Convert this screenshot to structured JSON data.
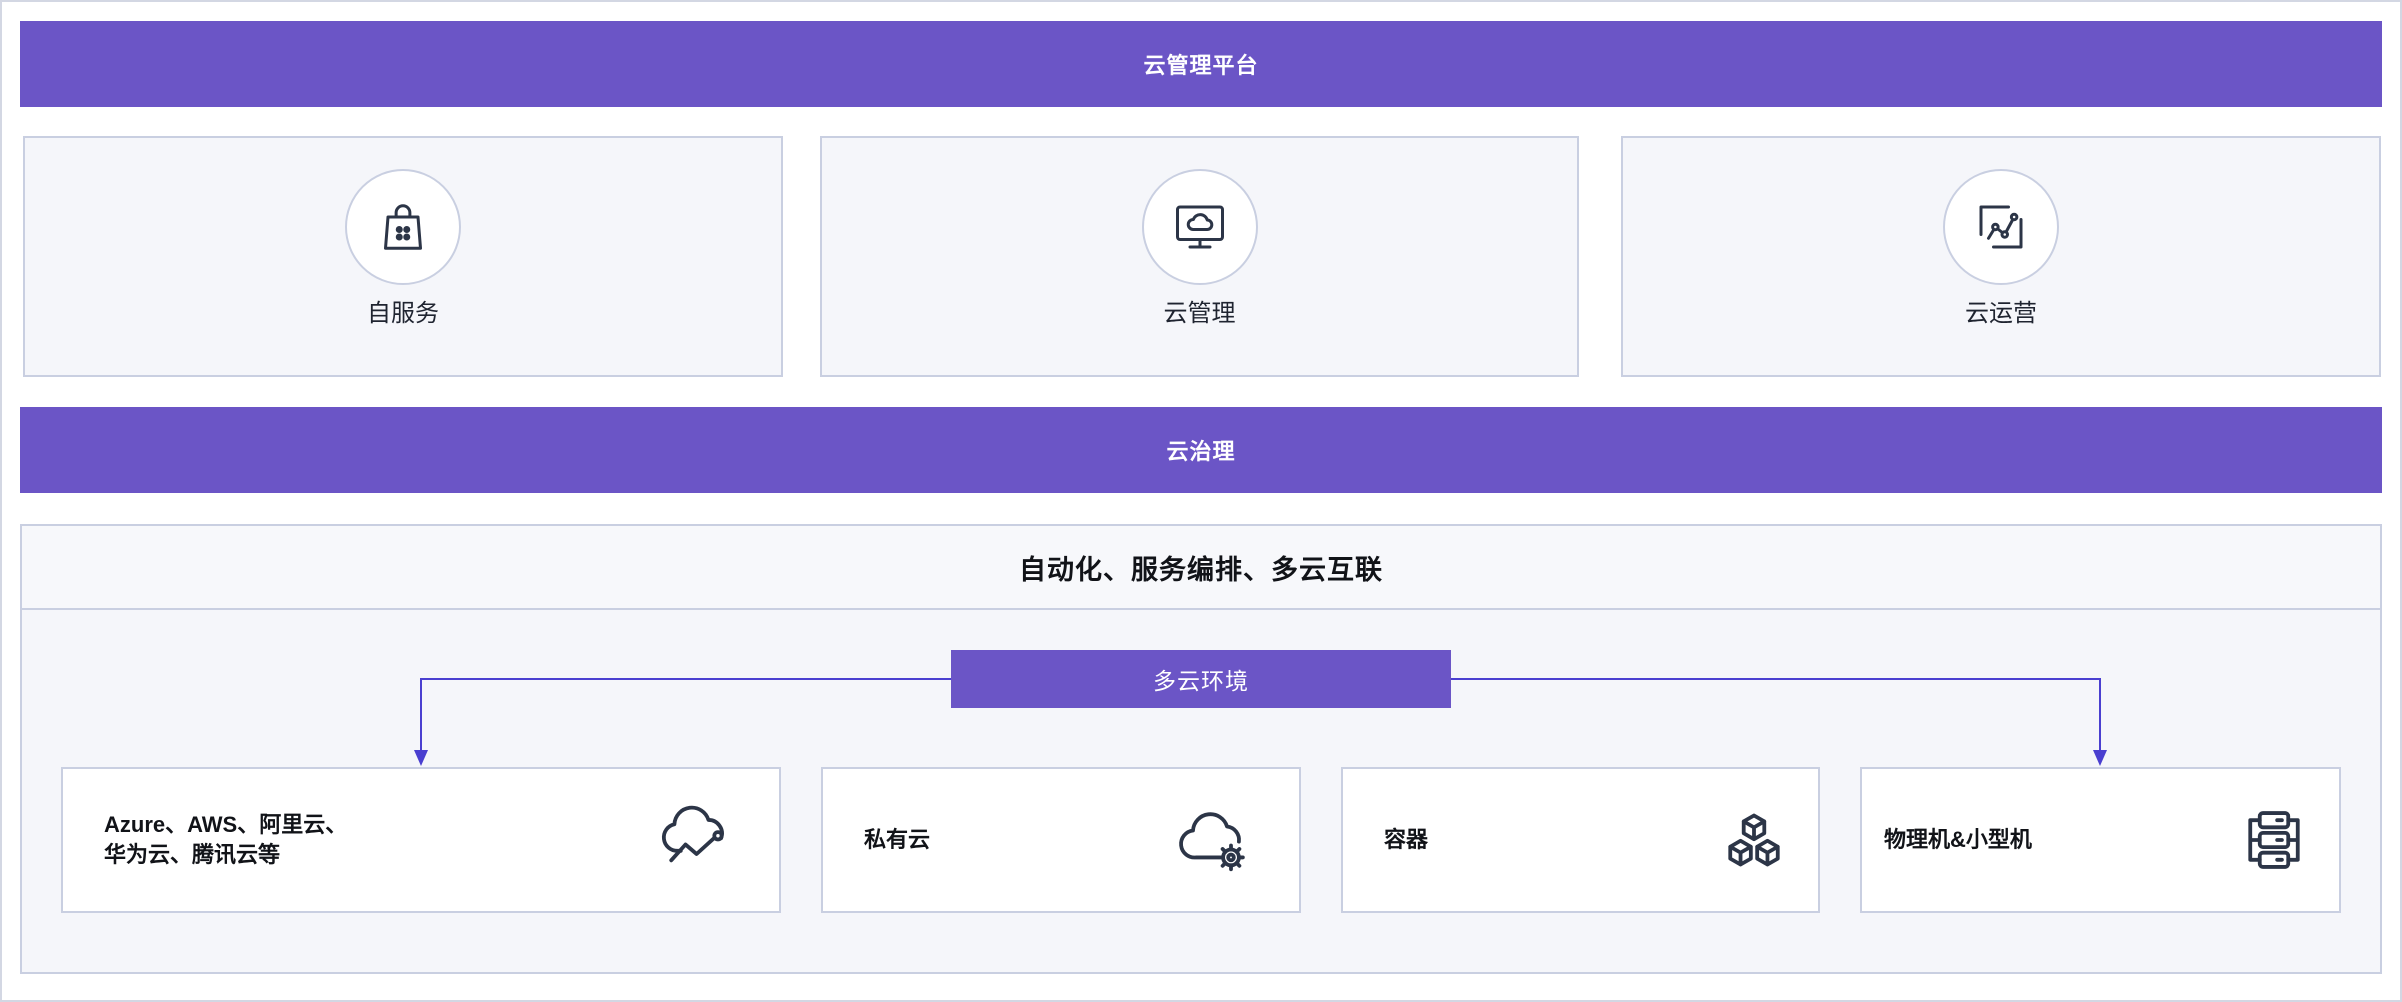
{
  "platform": {
    "title": "云管理平台"
  },
  "modules": [
    {
      "label": "自服务",
      "icon": "shopping-bag-icon"
    },
    {
      "label": "云管理",
      "icon": "monitor-cloud-icon"
    },
    {
      "label": "云运营",
      "icon": "line-chart-icon"
    }
  ],
  "governance": {
    "title": "云治理"
  },
  "environment": {
    "header": "自动化、服务编排、多云互联",
    "hub": "多云环境",
    "targets": [
      {
        "lines": [
          "Azure、AWS、阿里云、",
          "华为云、腾讯云等"
        ],
        "icon": "cloud-trend-icon"
      },
      {
        "lines": [
          "私有云"
        ],
        "icon": "cloud-gear-icon"
      },
      {
        "lines": [
          "容器"
        ],
        "icon": "cubes-icon"
      },
      {
        "lines": [
          "物理机&小型机"
        ],
        "icon": "server-rack-icon"
      }
    ]
  },
  "colors": {
    "accent": "#6b55c6",
    "connector": "#4a3fd0",
    "border": "#c9cfe1",
    "panel": "#f5f6fa",
    "icon": "#2c3547"
  }
}
